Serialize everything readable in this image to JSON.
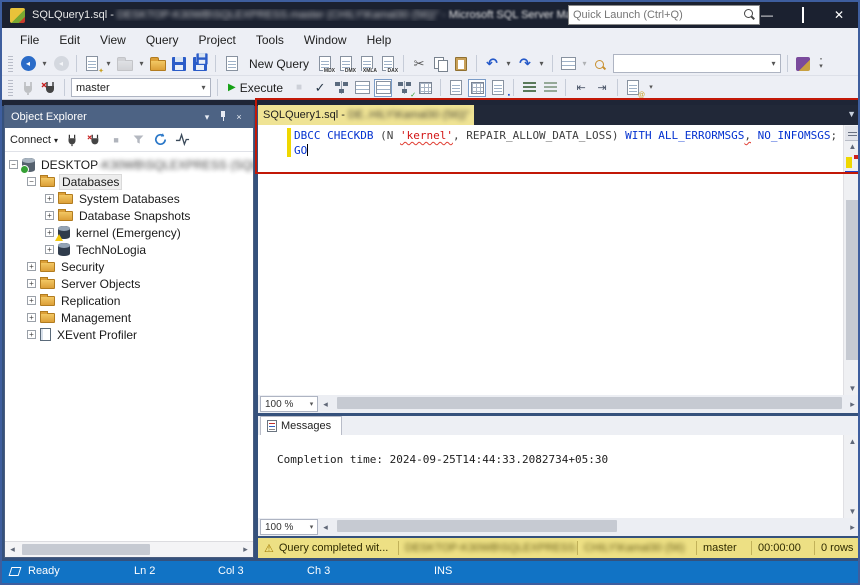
{
  "colors": {
    "annotation_box": "#C21807",
    "titlebar_bg": "#1B2130",
    "toolbar_bg": "#EDEFF5",
    "panel_header_bg": "#4D6384",
    "active_tab_bg": "#EFE394",
    "keyword_blue": "#0432D0",
    "string_red": "#D21414",
    "status_strip_bg": "#EDE084",
    "statusbar_bg": "#1173C5",
    "execute_green": "#15A015"
  },
  "titlebar": {
    "title_prefix": "SQLQuery1.sql - ",
    "title_redacted": "DESKTOP-K30WB\\SQLEXPRESS.master (CHILY\\Kamal30 (56))\" -",
    "title_suffix": " Microsoft SQL Server Man...",
    "quick_launch_placeholder": "Quick Launch (Ctrl+Q)",
    "minimize_glyph": "—",
    "close_glyph": "✕"
  },
  "menu": {
    "items": [
      {
        "label": "File"
      },
      {
        "label": "Edit"
      },
      {
        "label": "View"
      },
      {
        "label": "Query"
      },
      {
        "label": "Project"
      },
      {
        "label": "Tools"
      },
      {
        "label": "Window"
      },
      {
        "label": "Help"
      }
    ]
  },
  "toolbar1": {
    "new_query_label": "New Query",
    "mdx": "MDX",
    "dmx": "DMX",
    "xmla": "XMLA",
    "dax": "DAX",
    "search_value": ""
  },
  "toolbar2": {
    "database_value": "master",
    "execute_label": "Execute"
  },
  "object_explorer": {
    "title": "Object Explorer",
    "connect_label": "Connect",
    "tree": [
      {
        "exp": "−",
        "label": "DESKTOP",
        "redacted": "-K30WB\\SQLEXPRESS (SQL Serv"
      },
      {
        "exp": "−",
        "label": "Databases"
      },
      {
        "exp": "+",
        "label": "System Databases"
      },
      {
        "exp": "+",
        "label": "Database Snapshots"
      },
      {
        "exp": "+",
        "label": "kernel (Emergency)"
      },
      {
        "exp": "+",
        "label": "TechNoLogia"
      },
      {
        "exp": "+",
        "label": "Security"
      },
      {
        "exp": "+",
        "label": "Server Objects"
      },
      {
        "exp": "+",
        "label": "Replication"
      },
      {
        "exp": "+",
        "label": "Management"
      },
      {
        "exp": "+",
        "label": "XEvent Profiler"
      }
    ]
  },
  "editor": {
    "tab_title_prefix": "SQLQuery1.sql - ",
    "tab_title_redacted": "DE..HILY\\Kamal30 (56))\"",
    "sql": {
      "tokens1": [
        {
          "text": "DBCC"
        },
        {
          "text": " "
        },
        {
          "text": "CHECKDB"
        },
        {
          "text": " (N "
        },
        {
          "text": "'kernel'"
        },
        {
          "text": ", REPAIR_ALLOW_DATA_LOSS) "
        },
        {
          "text": "WITH"
        },
        {
          "text": " "
        },
        {
          "text": "ALL_ERRORMSGS"
        },
        {
          "text": ","
        },
        {
          "text": " "
        },
        {
          "text": "NO_INFOMSGS"
        },
        {
          "text": ";"
        }
      ],
      "line2": "GO"
    },
    "zoom_value": "100 %"
  },
  "messages": {
    "tab_label": "Messages",
    "content": "Completion time: 2024-09-25T14:44:33.2082734+05:30",
    "zoom_value": "100 %"
  },
  "status_strip": {
    "message": "Query completed wit...",
    "server_redacted": "DESKTOP-K30WB\\SQLEXPRESS (15...",
    "user_redacted": "CHILY\\Kamal30 (56)",
    "database": "master",
    "time": "00:00:00",
    "rows": "0 rows"
  },
  "statusbar": {
    "state": "Ready",
    "line": "Ln 2",
    "col": "Col 3",
    "ch": "Ch 3",
    "mode": "INS"
  }
}
